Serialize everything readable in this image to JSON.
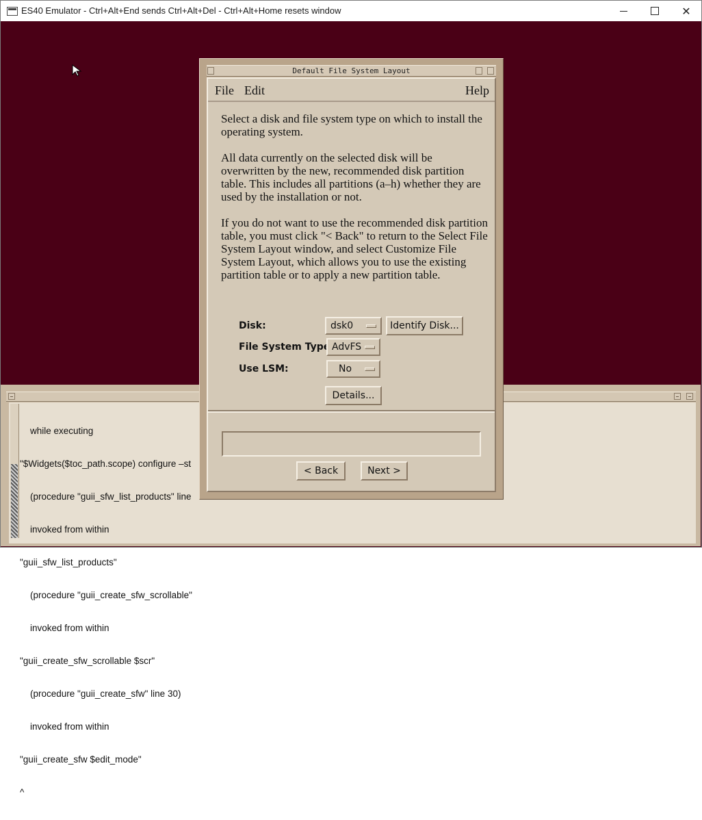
{
  "window": {
    "title": "ES40 Emulator - Ctrl+Alt+End sends Ctrl+Alt+Del - Ctrl+Alt+Home resets window",
    "minimize_icon": "minimize-icon",
    "maximize_icon": "maximize-icon",
    "close_icon": "close-icon",
    "background_color": "#4a0016"
  },
  "console": {
    "lines": [
      "    while executing",
      "\"$Widgets($toc_path.scope) configure –st",
      "    (procedure \"guii_sfw_list_products\" line",
      "    invoked from within",
      "\"guii_sfw_list_products\"",
      "    (procedure \"guii_create_sfw_scrollable\"",
      "    invoked from within",
      "\"guii_create_sfw_scrollable $scr\"",
      "    (procedure \"guii_create_sfw\" line 30)",
      "    invoked from within",
      "\"guii_create_sfw $edit_mode\"",
      "^"
    ]
  },
  "dialog": {
    "title": "Default File System Layout",
    "menu": {
      "file": "File",
      "edit": "Edit",
      "help": "Help"
    },
    "paragraphs": {
      "p1": "Select a disk and file system type on which to install the operating system.",
      "p2": "All data currently on the selected disk will be overwritten by the new, recommended disk partition table.  This includes all partitions (a–h) whether they are used by the installation or not.",
      "p3": "If you do not want to use the recommended disk partition table, you must click \"< Back\" to return to the Select File System Layout window, and select Customize File System Layout, which allows you to use the existing partition table or to apply a new partition table."
    },
    "fields": {
      "disk_label": "Disk:",
      "disk_value": "dsk0",
      "identify_button": "Identify Disk...",
      "fstype_label": "File System Type:",
      "fstype_value": "AdvFS",
      "lsm_label": "Use LSM:",
      "lsm_value": "No",
      "details_button": "Details..."
    },
    "status_text": "",
    "buttons": {
      "back": "< Back",
      "next": "Next >"
    }
  }
}
